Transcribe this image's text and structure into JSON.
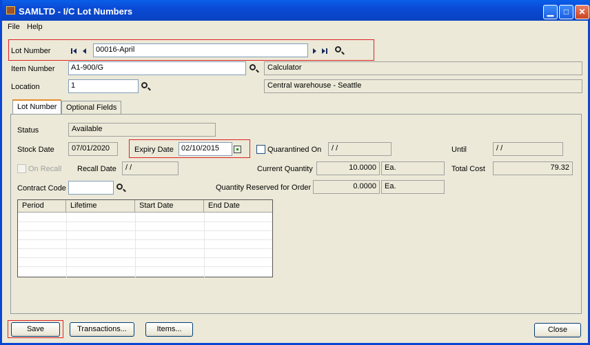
{
  "window": {
    "title": "SAMLTD - I/C Lot Numbers"
  },
  "menu": [
    {
      "label": "File"
    },
    {
      "label": "Help"
    }
  ],
  "header": {
    "lot_number": {
      "label": "Lot Number",
      "value": "00016-April"
    },
    "item_number": {
      "label": "Item Number",
      "value": "A1-900/G",
      "description": "Calculator"
    },
    "location": {
      "label": "Location",
      "value": "1",
      "description": "Central warehouse - Seattle"
    }
  },
  "tabs": [
    {
      "label": "Lot Number",
      "active": true
    },
    {
      "label": "Optional Fields",
      "active": false
    }
  ],
  "lot": {
    "status": {
      "label": "Status",
      "value": "Available"
    },
    "stock_date": {
      "label": "Stock Date",
      "value": "07/01/2020"
    },
    "expiry_date": {
      "label": "Expiry Date",
      "value": "02/10/2015"
    },
    "quarantined_on": {
      "label": "Quarantined On",
      "value": " /  /",
      "checked": false
    },
    "until": {
      "label": "Until",
      "value": " /  /"
    },
    "on_recall": {
      "label": "On Recall",
      "checked": false,
      "enabled": false
    },
    "recall_date": {
      "label": "Recall Date",
      "value": " /  /"
    },
    "current_quantity": {
      "label": "Current Quantity",
      "value": "10.0000",
      "unit": "Ea."
    },
    "total_cost": {
      "label": "Total Cost",
      "value": "79.32"
    },
    "contract_code": {
      "label": "Contract Code",
      "value": ""
    },
    "qty_reserved": {
      "label": "Quantity Reserved for Order",
      "value": "0.0000",
      "unit": "Ea."
    }
  },
  "grid": {
    "columns": [
      "Period",
      "Lifetime",
      "Start Date",
      "End Date"
    ],
    "rows": []
  },
  "buttons": {
    "save": "Save",
    "transactions": "Transactions...",
    "items": "Items...",
    "close": "Close"
  },
  "colors": {
    "titlebar": "#0a4ad6",
    "highlight_box": "#e02020",
    "active_tab_accent": "#e68b2c"
  }
}
